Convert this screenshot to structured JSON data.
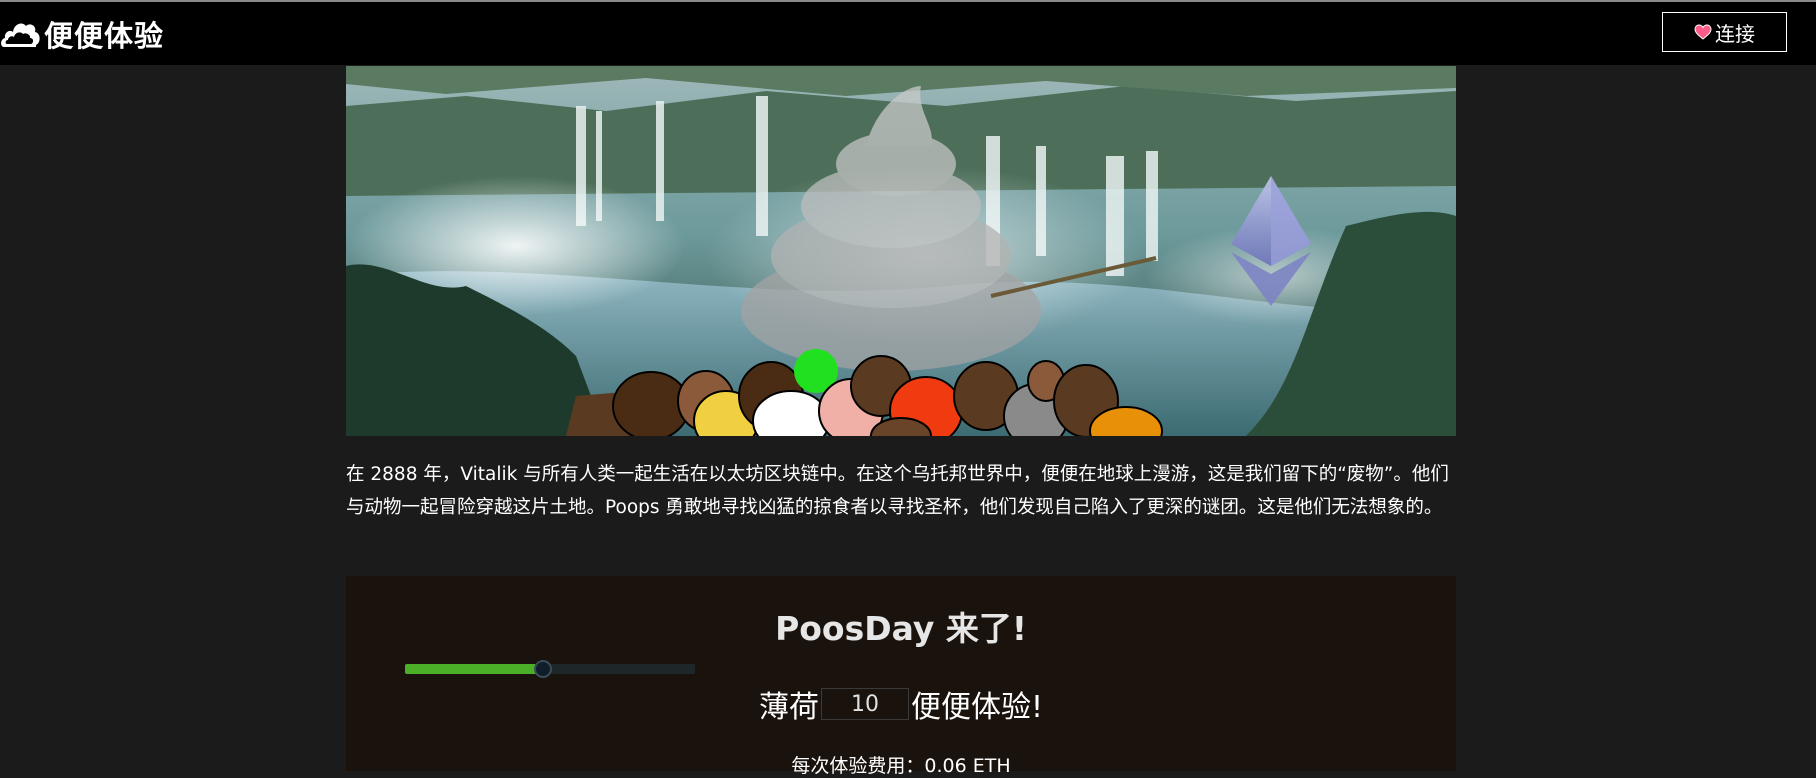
{
  "app": {
    "brand_title": "便便体验",
    "connect_label": "连接"
  },
  "icons": {
    "brand": "cloud-poop-logo-icon",
    "connect": "heart-icon"
  },
  "hero": {
    "image": "fantasy-waterfall-landscape-with-poop-and-ethereum-logo"
  },
  "story": {
    "text": "在 2888 年，Vitalik 与所有人类一起生活在以太坊区块链中。在这个乌托邦世界中，便便在地球上漫游，这是我们留下的“废物”。他们与动物一起冒险穿越这片土地。Poops 勇敢地寻找凶猛的掠食者以寻找圣杯，他们发现自己陷入了更深的谜团。这是他们无法想象的。"
  },
  "mint": {
    "title": "PoosDay 来了!",
    "prefix": "薄荷",
    "quantity": "10",
    "suffix": "便便体验!",
    "slider_value": 10,
    "slider_max": 21,
    "price_text": "每次体验费用：0.06 ETH"
  },
  "colors": {
    "background": "#1b1b1b",
    "topbar": "#000000",
    "panel": "#1a120c",
    "slider_fill": "#4caf28",
    "heart": "#ff5c8a"
  }
}
